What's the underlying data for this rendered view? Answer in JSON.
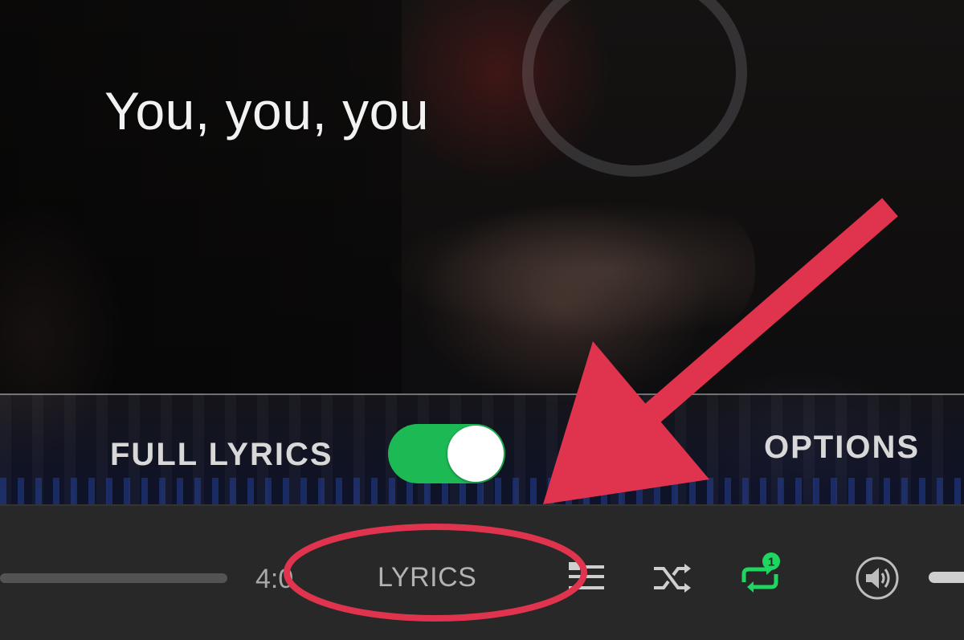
{
  "lyrics_view": {
    "current_line": "You, you, you",
    "full_lyrics_label": "FULL LYRICS",
    "full_lyrics_enabled": true,
    "options_label": "OPTIONS"
  },
  "player_bar": {
    "time_total": "4:0",
    "lyrics_label": "LYRICS",
    "repeat_badge": "1",
    "icons": [
      "queue-icon",
      "shuffle-icon",
      "repeat-one-icon",
      "volume-icon"
    ]
  },
  "colors": {
    "accent_green": "#1db954",
    "annotation_red": "#e0344e",
    "bar_background": "#282828"
  }
}
